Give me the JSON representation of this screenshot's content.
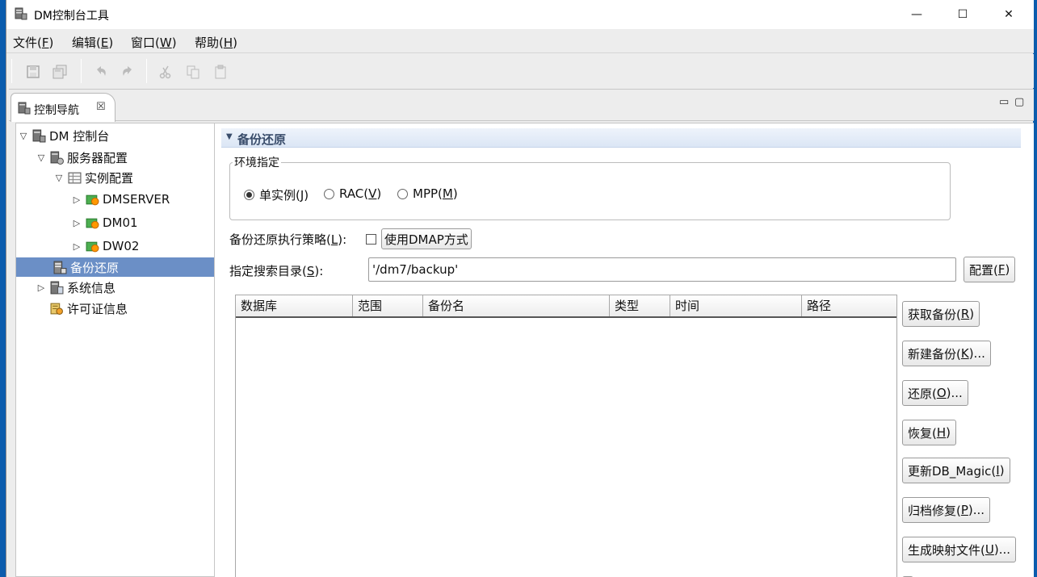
{
  "window": {
    "title": "DM控制台工具",
    "controls": {
      "minimize": "—",
      "maximize": "☐",
      "close": "✕"
    }
  },
  "menubar": [
    {
      "pre": "文件(",
      "key": "F",
      "post": ")"
    },
    {
      "pre": "编辑(",
      "key": "E",
      "post": ")"
    },
    {
      "pre": "窗口(",
      "key": "W",
      "post": ")"
    },
    {
      "pre": "帮助(",
      "key": "H",
      "post": ")"
    }
  ],
  "toolbar_icons": [
    "save-icon",
    "save-all-icon",
    "undo-icon",
    "redo-icon",
    "cut-icon",
    "copy-icon",
    "paste-icon"
  ],
  "view_tab": {
    "label": "控制导航",
    "close": "☒",
    "minimize": "▭",
    "maximize": "▢"
  },
  "tree": [
    {
      "label": "DM 控制台",
      "toggle": "▽",
      "icon": "server-icon",
      "level": 0
    },
    {
      "label": "服务器配置",
      "toggle": "▽",
      "icon": "server-config-icon",
      "level": 1
    },
    {
      "label": "实例配置",
      "toggle": "▽",
      "icon": "instance-config-icon",
      "level": 2
    },
    {
      "label": "DMSERVER",
      "toggle": "▷",
      "icon": "instance-icon",
      "level": 3
    },
    {
      "label": "DM01",
      "toggle": "▷",
      "icon": "instance-icon",
      "level": 3
    },
    {
      "label": "DW02",
      "toggle": "▷",
      "icon": "instance-icon",
      "level": 3
    },
    {
      "label": "备份还原",
      "toggle": "",
      "icon": "backup-icon",
      "level": 1,
      "selected": true
    },
    {
      "label": "系统信息",
      "toggle": "▷",
      "icon": "system-info-icon",
      "level": 1
    },
    {
      "label": "许可证信息",
      "toggle": "",
      "icon": "license-icon",
      "level": 1
    }
  ],
  "section": {
    "title": "备份还原",
    "env": {
      "legend": "环境指定",
      "options": [
        {
          "pre": "单实例(",
          "key": "J",
          "post": ")",
          "checked": true
        },
        {
          "pre": "RAC(",
          "key": "V",
          "post": ")",
          "checked": false
        },
        {
          "pre": "MPP(",
          "key": "M",
          "post": ")",
          "checked": false
        }
      ]
    },
    "strategy": {
      "pre": "备份还原执行策略(",
      "key": "L",
      "post": "):",
      "checkbox_label": "使用DMAP方式",
      "checked": false
    },
    "search_dir": {
      "pre": "指定搜索目录(",
      "key": "S",
      "post": "):",
      "value": "'/dm7/backup'",
      "config": {
        "pre": "配置(",
        "key": "F",
        "post": ")"
      }
    },
    "table": {
      "columns": [
        "数据库",
        "范围",
        "备份名",
        "类型",
        "时间",
        "路径"
      ],
      "rows": []
    },
    "actions": [
      {
        "pre": "获取备份(",
        "key": "R",
        "post": ")"
      },
      {
        "pre": "新建备份(",
        "key": "K",
        "post": ")..."
      },
      {
        "pre": "还原(",
        "key": "O",
        "post": ")..."
      },
      {
        "pre": "恢复(",
        "key": "H",
        "post": ")"
      },
      {
        "pre": "更新DB_Magic(",
        "key": "I",
        "post": ")"
      },
      {
        "pre": "归档修复(",
        "key": "P",
        "post": ")..."
      },
      {
        "pre": "生成映射文件(",
        "key": "U",
        "post": ")..."
      }
    ]
  }
}
